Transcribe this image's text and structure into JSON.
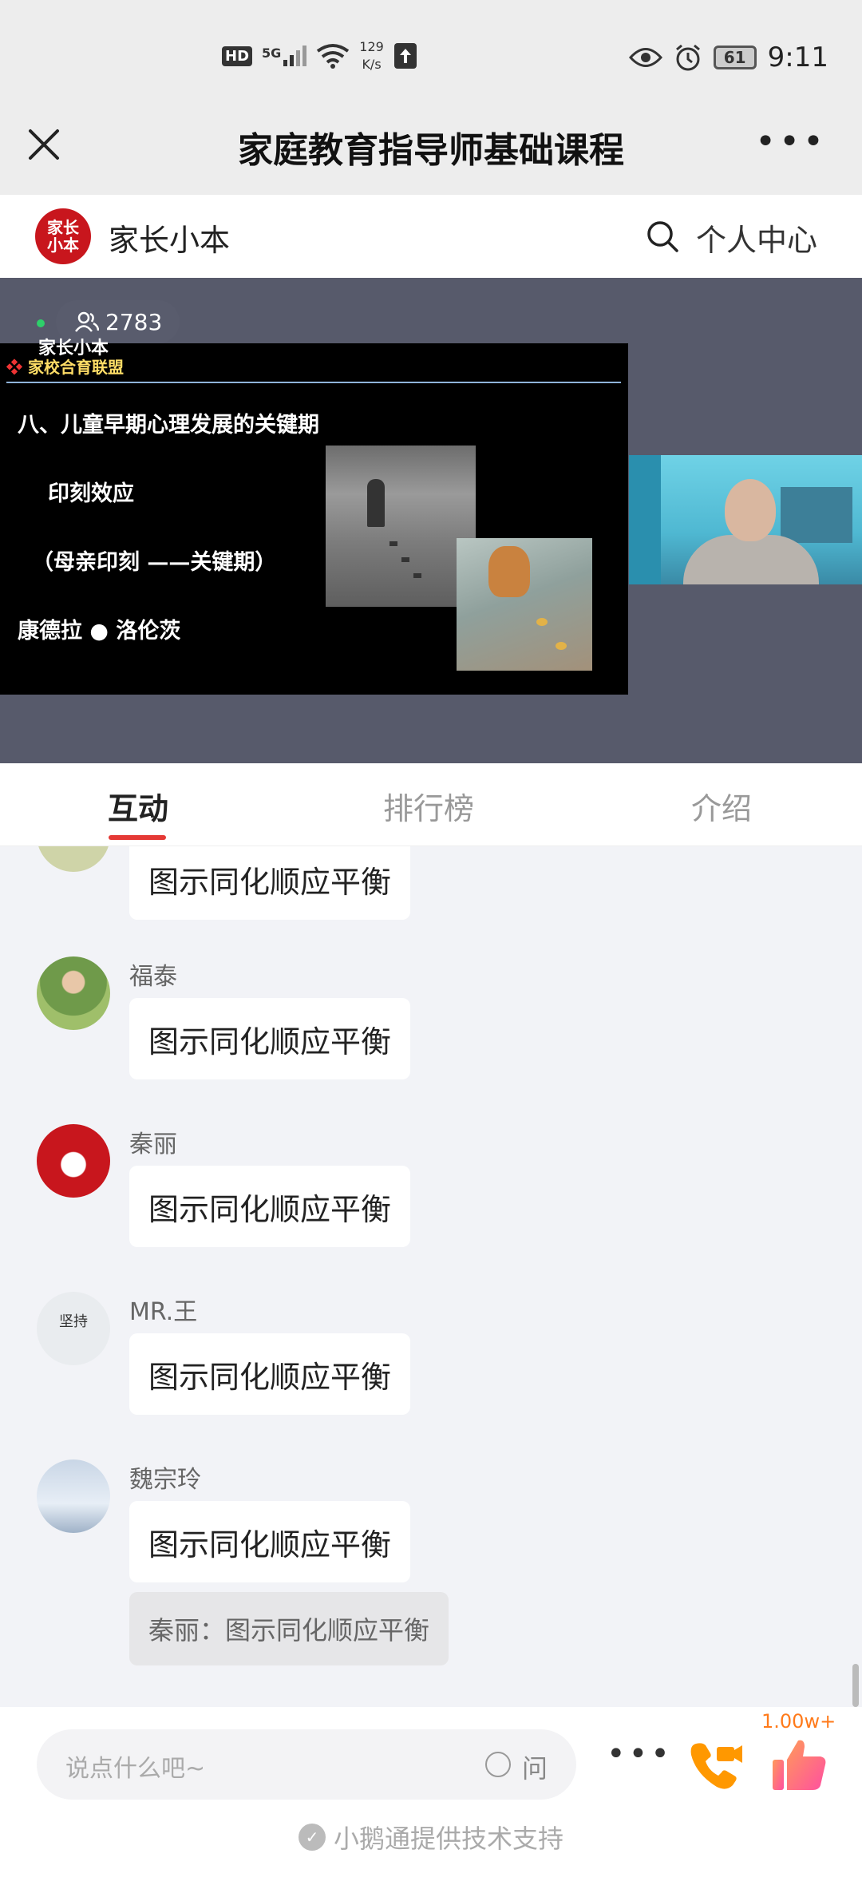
{
  "status_bar": {
    "hd": "HD",
    "network": "5G",
    "speed_value": "129",
    "speed_unit": "K/s",
    "battery": "61",
    "time": "9:11"
  },
  "title_bar": {
    "title": "家庭教育指导师基础课程"
  },
  "channel": {
    "logo_text": "家长小本",
    "name": "家长小本",
    "user_center": "个人中心"
  },
  "video": {
    "viewer_count": "2783",
    "slide": {
      "logo": "家长小本",
      "org": "家校合育联盟",
      "heading": "八、儿童早期心理发展的关键期",
      "line1": "印刻效应",
      "line2": "（母亲印刻 ——关键期）",
      "line3": "康德拉 ● 洛伦茨"
    }
  },
  "tabs": [
    {
      "label": "互动",
      "active": true
    },
    {
      "label": "排行榜",
      "active": false
    },
    {
      "label": "介绍",
      "active": false
    }
  ],
  "messages": [
    {
      "user": "",
      "text": "图示同化顺应平衡"
    },
    {
      "user": "福泰",
      "text": "图示同化顺应平衡"
    },
    {
      "user": "秦丽",
      "text": "图示同化顺应平衡"
    },
    {
      "user": "MR.王",
      "text": "图示同化顺应平衡",
      "avatar_text": "坚持"
    },
    {
      "user": "魏宗玲",
      "text": "图示同化顺应平衡",
      "quote": "秦丽：图示同化顺应平衡"
    }
  ],
  "bottom": {
    "input_placeholder": "说点什么吧~",
    "ask_label": "问",
    "like_count": "1.00w+",
    "support_text": "小鹅通提供技术支持"
  },
  "colors": {
    "accent": "#e53935",
    "like_orange": "#ff7a1a",
    "video_bg": "#575a6b"
  }
}
